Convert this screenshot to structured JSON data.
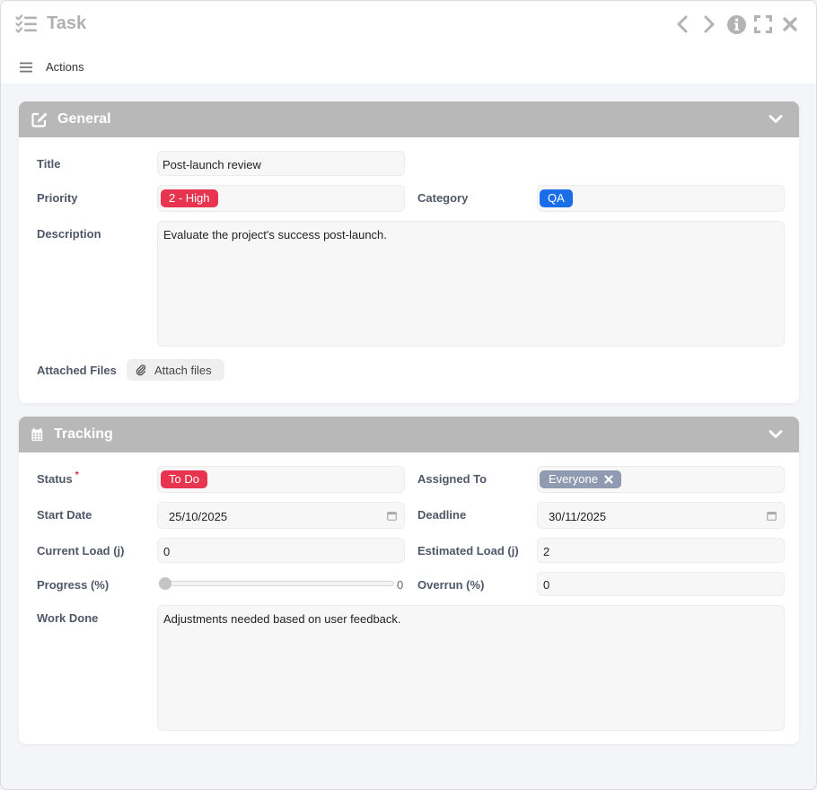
{
  "window": {
    "title": "Task",
    "icon": "checklist-icon"
  },
  "controls": {
    "prev": "chevron-left-icon",
    "next": "chevron-right-icon",
    "info": "info-icon",
    "maximize": "expand-icon",
    "close": "close-icon"
  },
  "actionbar": {
    "label": "Actions",
    "icon": "hamburger-icon"
  },
  "general": {
    "title": "General",
    "fields": {
      "title_label": "Title",
      "title_value": "Post-launch review",
      "priority_label": "Priority",
      "priority_value": "2 - High",
      "category_label": "Category",
      "category_value": "QA",
      "description_label": "Description",
      "description_value": "Evaluate the project's success post-launch.",
      "attached_label": "Attached Files",
      "attach_button": "Attach files"
    }
  },
  "tracking": {
    "title": "Tracking",
    "fields": {
      "status_label": "Status",
      "status_required": "*",
      "status_value": "To Do",
      "assigned_label": "Assigned To",
      "assigned_value": "Everyone",
      "start_label": "Start Date",
      "start_value": "25/10/2025",
      "deadline_label": "Deadline",
      "deadline_value": "30/11/2025",
      "current_load_label": "Current Load (j)",
      "current_load_value": "0",
      "estimated_load_label": "Estimated Load (j)",
      "estimated_load_value": "2",
      "progress_label": "Progress (%)",
      "progress_value": "0",
      "overrun_label": "Overrun (%)",
      "overrun_value": "0",
      "work_done_label": "Work Done",
      "work_done_value": "Adjustments needed based on user feedback."
    }
  },
  "colors": {
    "high": "#e8354f",
    "qa": "#1a6fe8",
    "todo": "#e8354f",
    "everyone": "#8f9bb0",
    "header": "#b8b8b8"
  }
}
